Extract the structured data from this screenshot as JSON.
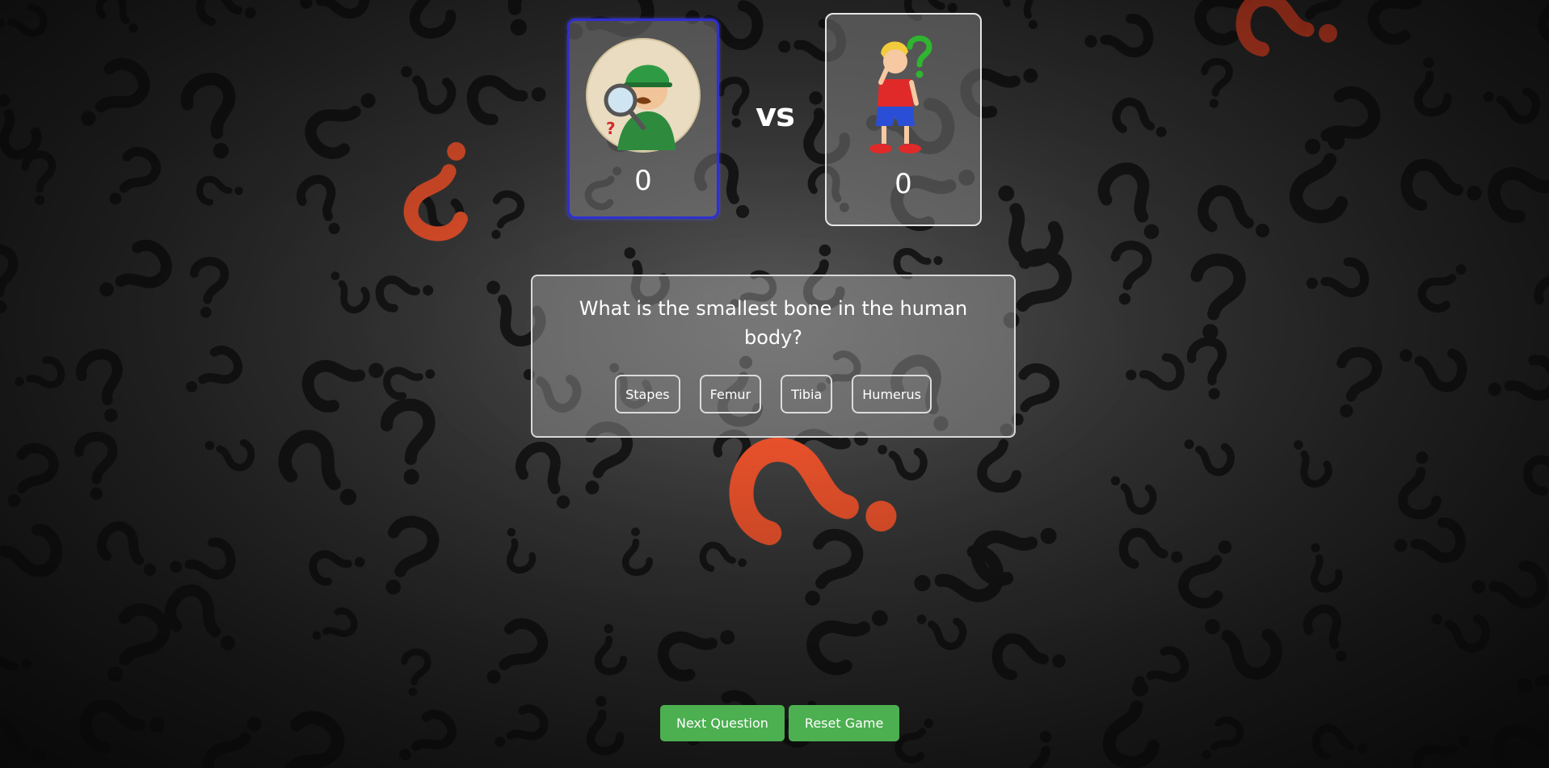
{
  "background": {
    "decoration": "question-marks-icon",
    "colors": {
      "base": "#2a2a2a",
      "mark_dark": "#161616",
      "mark_accent": "#ff5a30"
    }
  },
  "players": [
    {
      "id": "detective",
      "avatar_icon": "detective-icon",
      "score": "0",
      "active": true,
      "border_color": "#2f2fd0"
    },
    {
      "id": "boy",
      "avatar_icon": "thinking-boy-icon",
      "score": "0",
      "active": false,
      "border_color": "#e6e6e6"
    }
  ],
  "versus_label": "vs",
  "question": {
    "text": "What is the smallest bone in the human body?",
    "answers": [
      "Stapes",
      "Femur",
      "Tibia",
      "Humerus"
    ]
  },
  "controls": {
    "next_label": "Next Question",
    "reset_label": "Reset Game",
    "button_color": "#4caf50"
  }
}
